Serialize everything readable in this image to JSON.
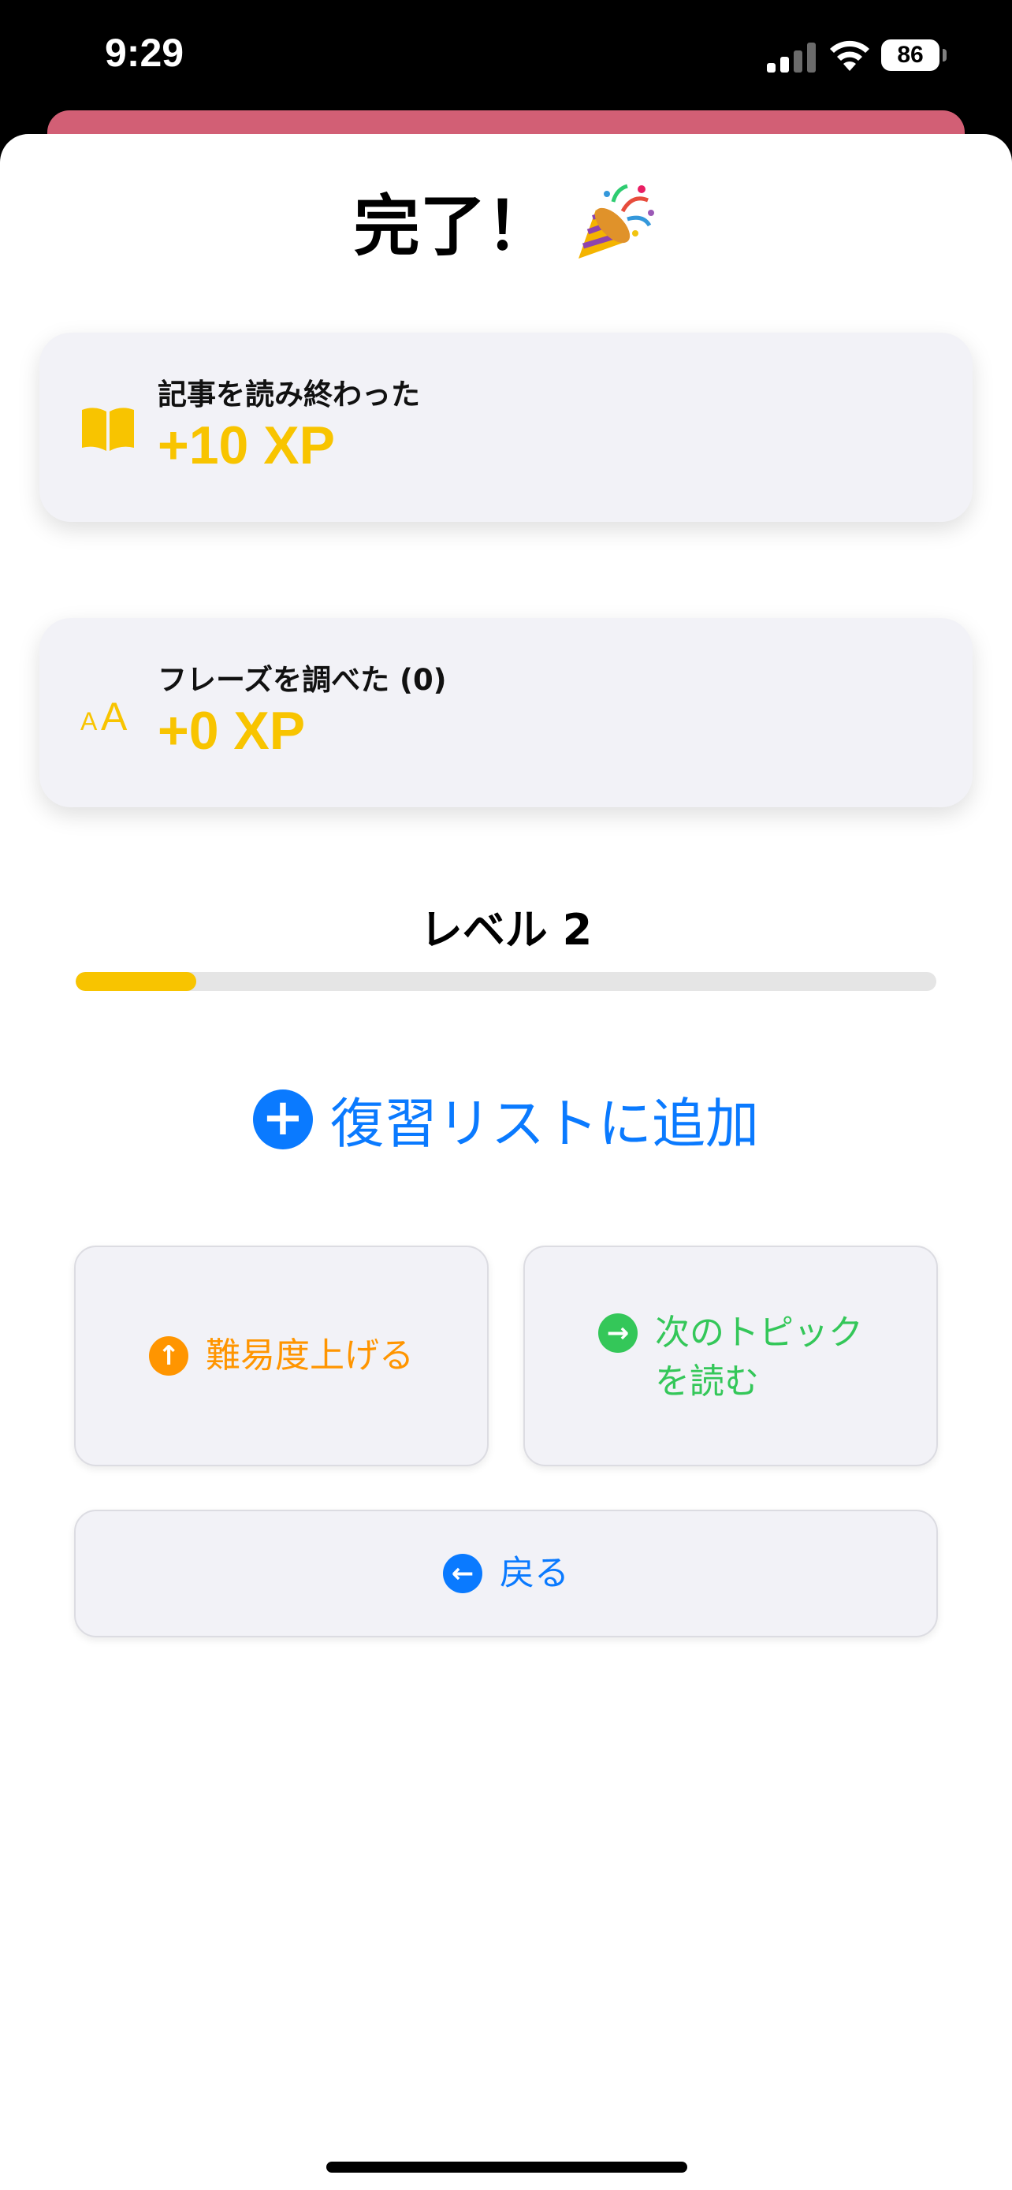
{
  "status_bar": {
    "time": "9:29",
    "battery": "86"
  },
  "header": {
    "title": "完了！",
    "icon": "party-popper-icon"
  },
  "cards": [
    {
      "icon": "book-icon",
      "label": "記事を読み終わった",
      "xp": "+10 XP"
    },
    {
      "icon": "text-size-icon",
      "label": "フレーズを調べた (0)",
      "xp": "+0 XP"
    }
  ],
  "level": {
    "label": "レベル 2",
    "progress": 0.14
  },
  "add_review": {
    "label": "復習リストに追加",
    "icon": "plus-circle-icon"
  },
  "buttons": {
    "harder": {
      "label": "難易度上げる",
      "icon": "arrow-up-circle-icon",
      "color": "#ff9500"
    },
    "next_topic": {
      "label_line1": "次のトピック",
      "label_line2": "を読む",
      "icon": "arrow-right-circle-icon",
      "color": "#34c759"
    },
    "back": {
      "label": "戻る",
      "icon": "arrow-left-circle-icon",
      "color": "#0a7aff"
    }
  },
  "colors": {
    "accent": "#0a7aff",
    "xp": "#f8c400",
    "card_bg": "#f2f2f7"
  }
}
